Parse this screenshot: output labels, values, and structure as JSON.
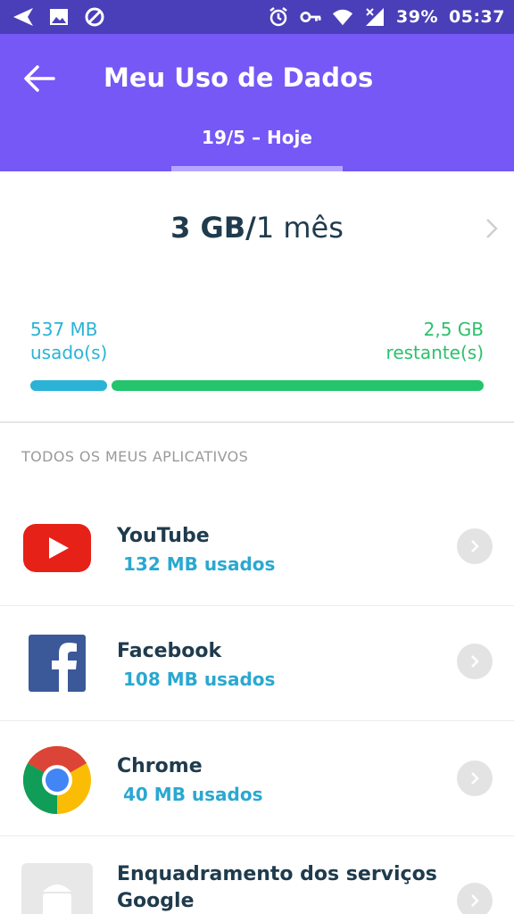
{
  "status_bar": {
    "battery": "39%",
    "time": "05:37",
    "left_icons": [
      "send-icon",
      "image-icon",
      "shield-icon"
    ],
    "right_icons": [
      "alarm-icon",
      "key-icon",
      "wifi-icon",
      "signal-icon"
    ]
  },
  "header": {
    "title": "Meu Uso de Dados",
    "period": "19/5 – Hoje"
  },
  "plan": {
    "amount": "3 GB/",
    "duration": "1 mês"
  },
  "usage": {
    "used_value": "537 MB",
    "used_label": "usado(s)",
    "remaining_value": "2,5 GB",
    "remaining_label": "restante(s)",
    "used_fraction": 0.17,
    "colors": {
      "used": "#2ab3d6",
      "remaining": "#24c46c"
    }
  },
  "apps_section": {
    "label": "TODOS OS MEUS APLICATIVOS",
    "items": [
      {
        "name": "YouTube",
        "usage": "132 MB usados",
        "icon": "youtube-icon"
      },
      {
        "name": "Facebook",
        "usage": "108 MB usados",
        "icon": "facebook-icon"
      },
      {
        "name": "Chrome",
        "usage": "40 MB usados",
        "icon": "chrome-icon"
      },
      {
        "name": "Enquadramento dos serviços Google",
        "name_line1": "Enquadramento dos serviços",
        "name_line2": "Google",
        "usage": "",
        "icon": "android-icon"
      }
    ]
  },
  "colors": {
    "header": "#7558f5",
    "status_bar": "#4a3fb8",
    "text_dark": "#1f3b4d"
  }
}
